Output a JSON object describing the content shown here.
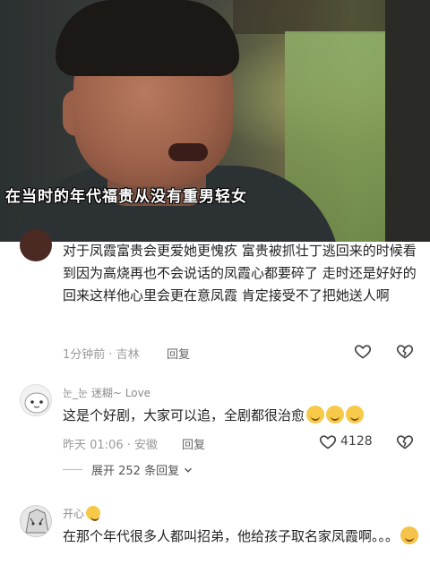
{
  "video": {
    "subtitle": "在当时的年代福贵从没有重男轻女"
  },
  "comments": [
    {
      "text": "对于凤霞富贵会更爱她更愧疚  富贵被抓壮丁逃回来的时候看到因为高烧再也不会说话的凤霞心都要碎了 走时还是好好的 回来这样他心里会更在意凤霞 肯定接受不了把她送人啊",
      "time": "1分钟前 · 吉林",
      "reply_label": "回复"
    },
    {
      "username": "눈_눈 迷糊~ Love",
      "text": "这是个好剧，大家可以追，全剧都很治愈",
      "time": "昨天 01:06 · 安徽",
      "reply_label": "回复",
      "like_count": "4128",
      "expand_label": "展开 252 条回复"
    },
    {
      "username": "开心",
      "text": "在那个年代很多人都叫招弟，他给孩子取名家凤霞啊。。。"
    }
  ],
  "icons": {
    "like": "heart-outline-icon",
    "dislike": "broken-heart-icon",
    "expand": "chevron-down-icon",
    "emoji": "grinning-face-icon",
    "sweat_emoji": "sad-face-icon"
  }
}
